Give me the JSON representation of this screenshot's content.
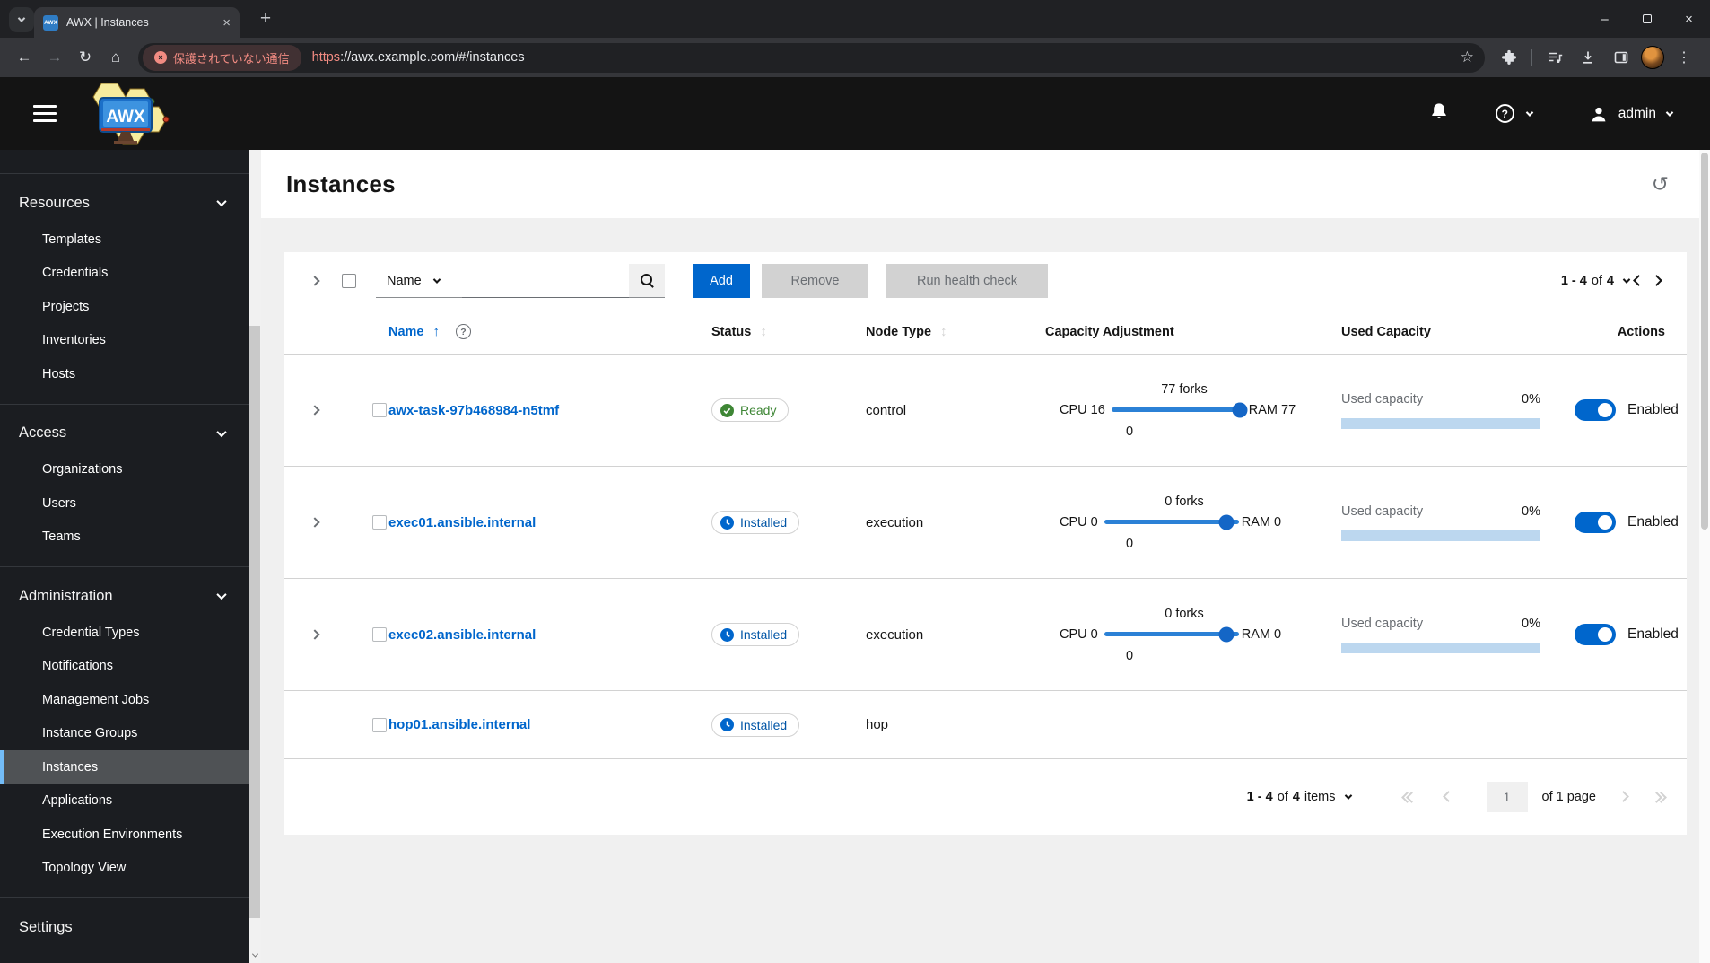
{
  "browser": {
    "tab": {
      "favicon_text": "AWX",
      "title": "AWX | Instances"
    },
    "address": {
      "security_badge": "保護されていない通信",
      "https": "https",
      "rest": "://awx.example.com/#/instances"
    }
  },
  "icons": {
    "back": "←",
    "forward": "→",
    "reload": "↻",
    "home": "⌂",
    "star": "☆",
    "kebab": "⋮",
    "plus": "+",
    "close": "×",
    "minimize": "–",
    "not_secure": "×",
    "history": "↺",
    "sort_asc": "↑",
    "sort_both": "↕",
    "help": "?"
  },
  "header": {
    "user": "admin"
  },
  "sidebar": {
    "groups": [
      {
        "label": "Resources",
        "items": [
          "Templates",
          "Credentials",
          "Projects",
          "Inventories",
          "Hosts"
        ]
      },
      {
        "label": "Access",
        "items": [
          "Organizations",
          "Users",
          "Teams"
        ]
      },
      {
        "label": "Administration",
        "items": [
          "Credential Types",
          "Notifications",
          "Management Jobs",
          "Instance Groups",
          "Instances",
          "Applications",
          "Execution Environments",
          "Topology View"
        ]
      },
      {
        "label": "Settings",
        "items": []
      }
    ],
    "selected": "Instances"
  },
  "page": {
    "title": "Instances"
  },
  "toolbar": {
    "filter_label": "Name",
    "add_label": "Add",
    "remove_label": "Remove",
    "health_label": "Run health check",
    "pagination": {
      "range": "1 - 4",
      "of": "of",
      "total": "4"
    }
  },
  "table": {
    "headers": {
      "name": "Name",
      "status": "Status",
      "node_type": "Node Type",
      "capacity": "Capacity Adjustment",
      "used": "Used Capacity",
      "actions": "Actions"
    },
    "rows": [
      {
        "name": "awx-task-97b468984-n5tmf",
        "status": "Ready",
        "node_type": "control",
        "forks": "77 forks",
        "cpu": "CPU 16",
        "ram": "RAM 77",
        "floor": "0",
        "used_label": "Used capacity",
        "used_pct": "0%",
        "state_label": "Enabled"
      },
      {
        "name": "exec01.ansible.internal",
        "status": "Installed",
        "node_type": "execution",
        "forks": "0 forks",
        "cpu": "CPU 0",
        "ram": "RAM 0",
        "floor": "0",
        "used_label": "Used capacity",
        "used_pct": "0%",
        "state_label": "Enabled"
      },
      {
        "name": "exec02.ansible.internal",
        "status": "Installed",
        "node_type": "execution",
        "forks": "0 forks",
        "cpu": "CPU 0",
        "ram": "RAM 0",
        "floor": "0",
        "used_label": "Used capacity",
        "used_pct": "0%",
        "state_label": "Enabled"
      },
      {
        "name": "hop01.ansible.internal",
        "status": "Installed",
        "node_type": "hop"
      }
    ]
  },
  "pagination": {
    "range": "1 - 4",
    "of": "of",
    "total": "4",
    "items_word": "items",
    "page": "1",
    "page_of": "of 1 page"
  },
  "colors": {
    "accent_blue": "#0066cc",
    "link_blue": "#0066cc",
    "ready_green": "#3e8635",
    "installed_blue": "#0066cc",
    "slider_blue": "#2b81d6",
    "selected_border": "#73bcf7",
    "not_secure_red": "#f28b82",
    "disabled_gray": "#d2d2d2"
  }
}
